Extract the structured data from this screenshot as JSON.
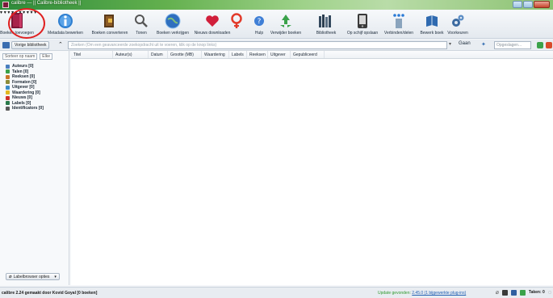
{
  "window": {
    "title": "calibre — || Calibre-bibliotheek ||"
  },
  "toolbar": {
    "items": [
      {
        "label": "Boeken toevoegen",
        "icon": "add-book-icon",
        "has_arrow": true
      },
      {
        "label": "Metadata bewerken",
        "icon": "info-icon",
        "has_arrow": true
      },
      {
        "label": "Boeken converteren",
        "icon": "convert-icon",
        "has_arrow": true
      },
      {
        "label": "Tonen",
        "icon": "view-icon",
        "has_arrow": true
      },
      {
        "label": "Boeken verkrijgen",
        "icon": "globe-icon",
        "has_arrow": true
      },
      {
        "label": "Nieuws downloaden",
        "icon": "heart-icon",
        "has_arrow": false
      },
      {
        "label": "Hulp",
        "icon": "lifebuoy-icon",
        "has_arrow": false
      },
      {
        "label": "Verwijder boeken",
        "icon": "recycle-icon",
        "has_arrow": true
      },
      {
        "label": "Bibliotheek",
        "icon": "library-icon",
        "has_arrow": true
      },
      {
        "label": "Op schijf opslaan",
        "icon": "device-icon",
        "has_arrow": true
      },
      {
        "label": "Verbinden/delen",
        "icon": "connect-icon",
        "has_arrow": true
      },
      {
        "label": "Bewerk boek",
        "icon": "edit-book-icon",
        "has_arrow": false
      },
      {
        "label": "Voorkeuren",
        "icon": "preferences-icon",
        "has_arrow": true
      }
    ],
    "colors": {
      "accent": "#e02020"
    }
  },
  "search": {
    "library_button": "Vorige bibliotheek",
    "placeholder": "Zoeken (Om een geavanceerde zoekopdracht uit te voeren, klik op de knop links)",
    "go_label": "Gaan",
    "saved_search_placeholder": "Opgeslagen..."
  },
  "sidebar": {
    "sort_label": "Sorteer op naam",
    "match_label": "Elke",
    "tags": [
      {
        "label": "Auteurs [0]",
        "icon": "user-icon",
        "color": "#4a7fbf"
      },
      {
        "label": "Talen [0]",
        "icon": "language-icon",
        "color": "#3aa24a"
      },
      {
        "label": "Reeksen [0]",
        "icon": "series-icon",
        "color": "#c9762a"
      },
      {
        "label": "Formaten [0]",
        "icon": "formats-icon",
        "color": "#8c8c3a"
      },
      {
        "label": "Uitgever [0]",
        "icon": "publisher-icon",
        "color": "#3a8cc9"
      },
      {
        "label": "Waardering [0]",
        "icon": "star-icon",
        "color": "#e2b81f"
      },
      {
        "label": "Nieuws [0]",
        "icon": "news-icon",
        "color": "#d0302a"
      },
      {
        "label": "Labels [0]",
        "icon": "tags-icon",
        "color": "#2a7a4a"
      },
      {
        "label": "Identificators [0]",
        "icon": "barcode-icon",
        "color": "#5a5a5a"
      }
    ],
    "bottom_button": "Labelbrowser opties"
  },
  "booklist": {
    "columns": [
      "Titel",
      "Auteur(s)",
      "Datum",
      "Grootte (MB)",
      "Waardering",
      "Labels",
      "Reeksen",
      "Uitgever",
      "Gepubliceerd"
    ],
    "rows": []
  },
  "status": {
    "left": "calibre 2.24 gemaakt door Kovid Goyal  [0 boeken]",
    "update_prefix": "Update gevonden: ",
    "update_version": "2.45.0 (1 bijgewerkte plug-ins)",
    "jobs": "Taken: 0"
  }
}
